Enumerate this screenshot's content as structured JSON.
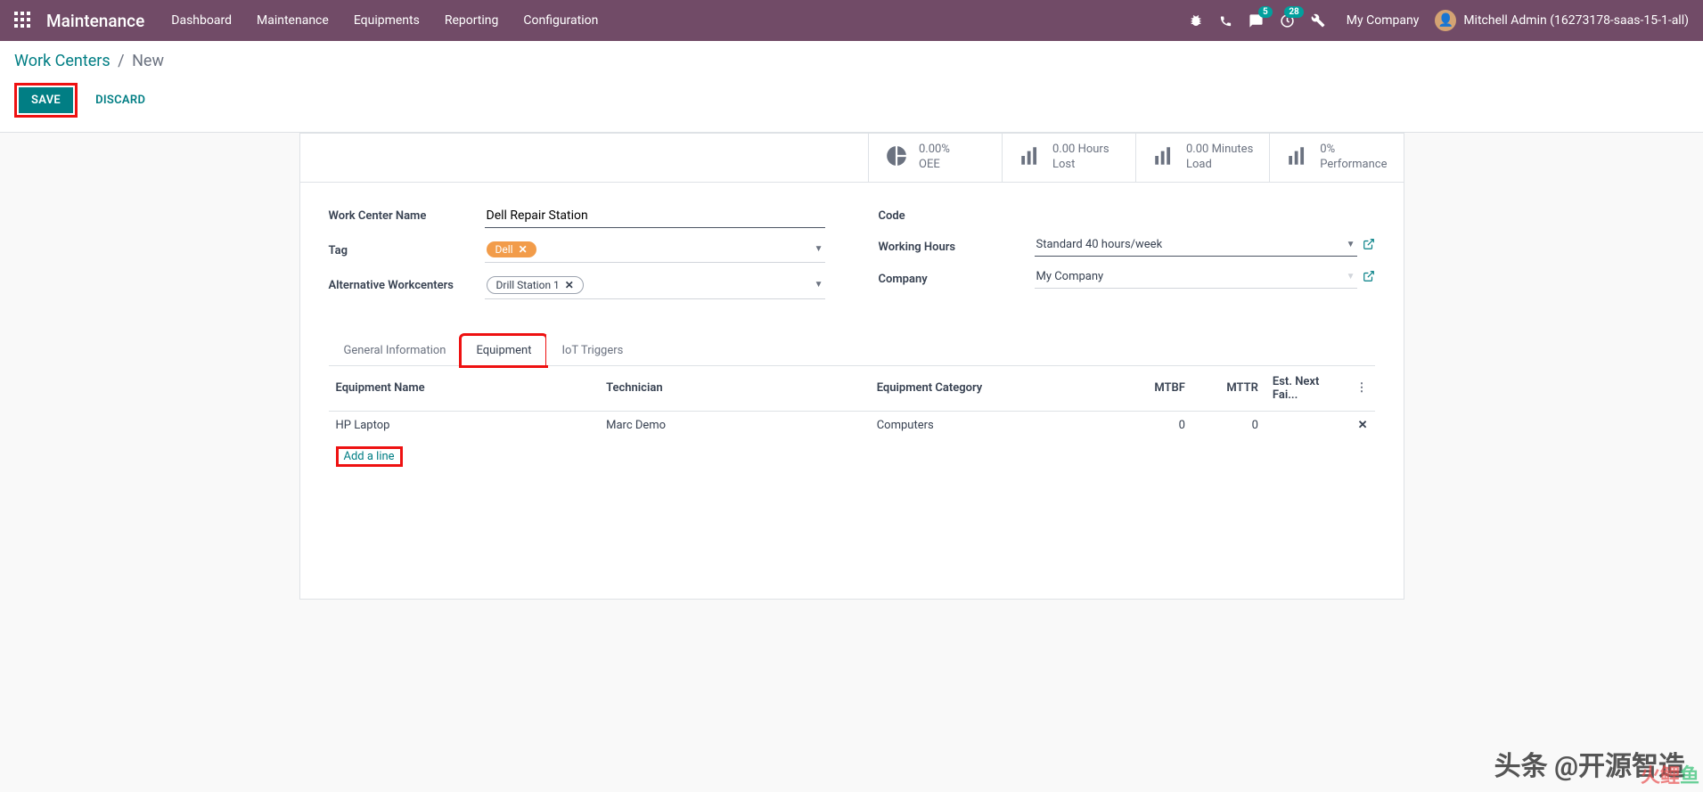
{
  "navbar": {
    "brand": "Maintenance",
    "menu": [
      "Dashboard",
      "Maintenance",
      "Equipments",
      "Reporting",
      "Configuration"
    ],
    "badges": {
      "messages": "5",
      "activities": "28"
    },
    "company": "My Company",
    "user": "Mitchell Admin (16273178-saas-15-1-all)"
  },
  "breadcrumb": {
    "parent": "Work Centers",
    "current": "New"
  },
  "actions": {
    "save": "SAVE",
    "discard": "DISCARD"
  },
  "stats": [
    {
      "value": "0.00%",
      "label": "OEE",
      "icon": "pie"
    },
    {
      "value": "0.00 Hours",
      "label": "Lost",
      "icon": "bars"
    },
    {
      "value": "0.00 Minutes",
      "label": "Load",
      "icon": "bars"
    },
    {
      "value": "0%",
      "label": "Performance",
      "icon": "bars"
    }
  ],
  "form": {
    "left": {
      "name_label": "Work Center Name",
      "name_value": "Dell Repair Station",
      "tag_label": "Tag",
      "tag_value": "Dell",
      "alt_label": "Alternative Workcenters",
      "alt_value": "Drill Station 1"
    },
    "right": {
      "code_label": "Code",
      "code_value": "",
      "hours_label": "Working Hours",
      "hours_value": "Standard 40 hours/week",
      "company_label": "Company",
      "company_value": "My Company"
    }
  },
  "tabs": [
    "General Information",
    "Equipment",
    "IoT Triggers"
  ],
  "equipment_table": {
    "headers": {
      "name": "Equipment Name",
      "tech": "Technician",
      "cat": "Equipment Category",
      "mtbf": "MTBF",
      "mttr": "MTTR",
      "next": "Est. Next Fai..."
    },
    "rows": [
      {
        "name": "HP Laptop",
        "tech": "Marc Demo",
        "cat": "Computers",
        "mtbf": "0",
        "mttr": "0",
        "next": ""
      }
    ],
    "add_line": "Add a line"
  },
  "watermark": {
    "cn": "头条 @开源智造",
    "fish1": "火鲤",
    "fish2": "鱼"
  }
}
